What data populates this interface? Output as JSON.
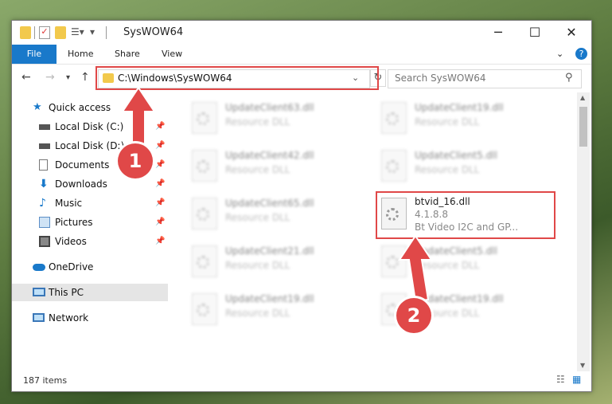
{
  "window": {
    "title": "SysWOW64",
    "controls": {
      "minimize": "─",
      "maximize": "☐",
      "close": "✕"
    }
  },
  "ribbon": {
    "file_tab": "File",
    "tabs": [
      "Home",
      "Share",
      "View"
    ],
    "help": "?"
  },
  "nav": {
    "back": "←",
    "forward": "→",
    "up": "↑",
    "address": "C:\\Windows\\SysWOW64",
    "search_placeholder": "Search SysWOW64"
  },
  "sidebar": {
    "items": [
      {
        "label": "Quick access",
        "pinned": false
      },
      {
        "label": "Local Disk (C:)",
        "pinned": true
      },
      {
        "label": "Local Disk (D:)",
        "pinned": true
      },
      {
        "label": "Documents",
        "pinned": true
      },
      {
        "label": "Downloads",
        "pinned": true
      },
      {
        "label": "Music",
        "pinned": true
      },
      {
        "label": "Pictures",
        "pinned": true
      },
      {
        "label": "Videos",
        "pinned": true
      },
      {
        "label": "OneDrive",
        "pinned": false
      },
      {
        "label": "This PC",
        "pinned": false,
        "selected": true
      },
      {
        "label": "Network",
        "pinned": false
      }
    ]
  },
  "files": [
    {
      "name": "UpdateClient63.dll",
      "sub": "Resource DLL"
    },
    {
      "name": "UpdateClient19.dll",
      "sub": "Resource DLL"
    },
    {
      "name": "UpdateClient42.dll",
      "sub": "Resource DLL"
    },
    {
      "name": "UpdateClient5.dll",
      "sub": "Resource DLL"
    },
    {
      "name": "UpdateClient65.dll",
      "sub": "Resource DLL"
    },
    {
      "name": "btvid_16.dll",
      "sub": "4.1.8.8",
      "sub2": "Bt Video I2C and GP...",
      "highlighted": true
    },
    {
      "name": "UpdateClient21.dll",
      "sub": "Resource DLL"
    },
    {
      "name": "UpdateClient5.dll",
      "sub": "Resource DLL"
    },
    {
      "name": "UpdateClient19.dll",
      "sub": "Resource DLL"
    },
    {
      "name": "UpdateClient19.dll",
      "sub": "Resource DLL"
    }
  ],
  "status": {
    "count": "187 items"
  },
  "annotations": {
    "one": "1",
    "two": "2"
  },
  "colors": {
    "accent": "#1979ca",
    "highlight": "#e04848"
  }
}
